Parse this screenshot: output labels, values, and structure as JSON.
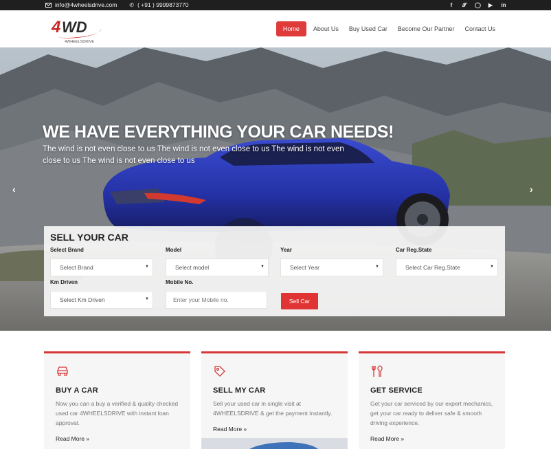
{
  "topbar": {
    "email": "info@4wheelsdrive.com",
    "phone": "( +91 ) 9999873770",
    "social_icons": [
      "facebook-icon",
      "twitter-icon",
      "instagram-icon",
      "youtube-icon",
      "linkedin-icon"
    ]
  },
  "header": {
    "logo_text": "4WD",
    "logo_tagline": "4WHEELSDRIVE",
    "nav": [
      "Home",
      "About Us",
      "Buy Used Car",
      "Become Our Partner",
      "Contact Us"
    ],
    "active_nav": "Home"
  },
  "hero": {
    "title": "WE HAVE EVERYTHING YOUR CAR NEEDS!",
    "subtitle": "The wind is not even close to us The wind is not even close to us The wind is not even close to us The wind is not even close to us",
    "prev_arrow": "‹",
    "next_arrow": "›"
  },
  "sell_form": {
    "heading": "SELL YOUR CAR",
    "brand_label": "Select Brand",
    "brand_value": "Select Brand",
    "model_label": "Model",
    "model_value": "Select model",
    "year_label": "Year",
    "year_value": "Select Year",
    "state_label": "Car Reg.State",
    "state_value": "Select Car Reg.State",
    "km_label": "Km Driven",
    "km_value": "Select Km Driven",
    "mobile_label": "Mobile No.",
    "mobile_placeholder": "Enter your Mobile no.",
    "submit_label": "Sell Car"
  },
  "cards": [
    {
      "title": "BUY A CAR",
      "text": "Now you can a buy a verified & quality checked used car 4WHEELSDRIVE with instant loan approval.",
      "link": "Read More",
      "icon": "car-icon"
    },
    {
      "title": "SELL MY CAR",
      "text": "Sell your used car in single visit at 4WHEELSDRIVE & get the payment instantly.",
      "link": "Read More",
      "icon": "tag-icon"
    },
    {
      "title": "GET SERVICE",
      "text": "Get your car serviced by our expert mechanics, get your car ready to deliver safe & smooth driving experience.",
      "link": "Read More",
      "icon": "tools-icon"
    }
  ],
  "colors": {
    "accent": "#e03b3b",
    "topbar": "#1f1f1f",
    "car_blue": "#2430a8"
  }
}
